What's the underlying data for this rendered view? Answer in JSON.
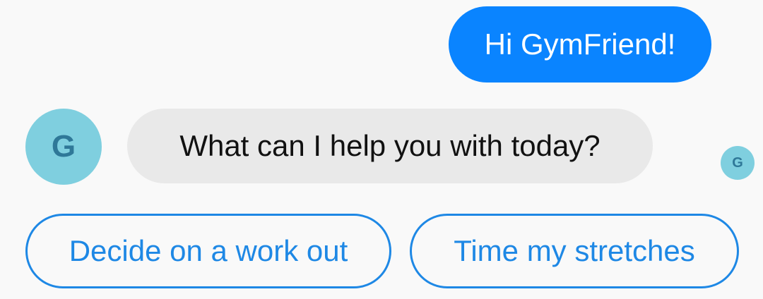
{
  "conversation": {
    "outgoing_message": "Hi GymFriend!",
    "incoming_message": "What can I help you with today?",
    "bot_avatar_letter": "G",
    "read_receipt_letter": "G"
  },
  "suggestions": [
    {
      "label": "Decide on a work out"
    },
    {
      "label": "Time my stretches"
    }
  ],
  "colors": {
    "outgoing_bubble": "#0a84ff",
    "incoming_bubble": "#e9e9e9",
    "avatar_background": "#7fcfdf",
    "avatar_letter": "#2f7898",
    "chip_accent": "#1e88e5",
    "background": "#f9f9f9"
  }
}
